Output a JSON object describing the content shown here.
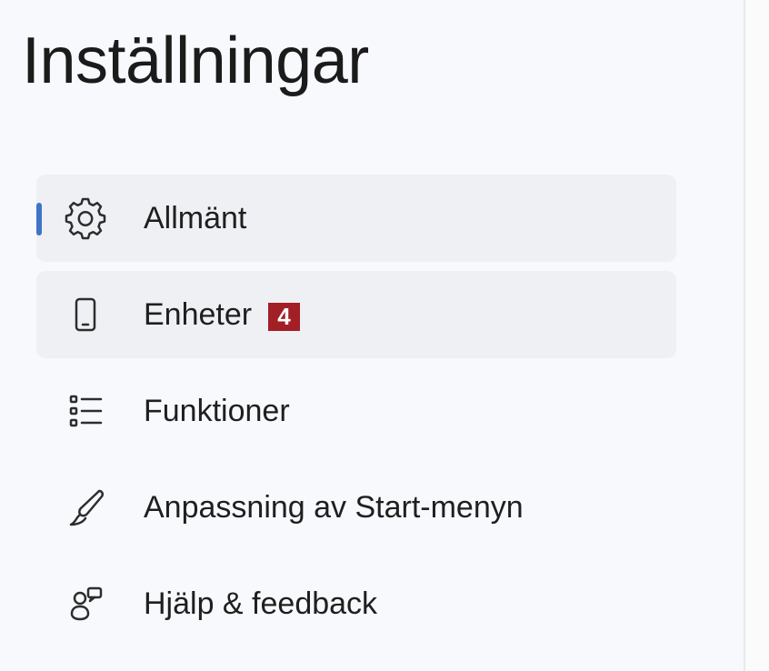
{
  "page": {
    "title": "Inställningar"
  },
  "navigation": {
    "items": [
      {
        "label": "Allmänt",
        "icon": "gear-icon",
        "active": true
      },
      {
        "label": "Enheter",
        "icon": "phone-icon",
        "badge": "4",
        "hover": true
      },
      {
        "label": "Funktioner",
        "icon": "feature-list-icon"
      },
      {
        "label": "Anpassning av Start-menyn",
        "icon": "brush-icon"
      },
      {
        "label": "Hjälp & feedback",
        "icon": "help-feedback-icon"
      }
    ]
  },
  "colors": {
    "background": "#f7f9fc",
    "selected_background": "#eef0f4",
    "accent": "#3f73c7",
    "badge": "#a21f25",
    "divider": "#e8e9ec"
  }
}
